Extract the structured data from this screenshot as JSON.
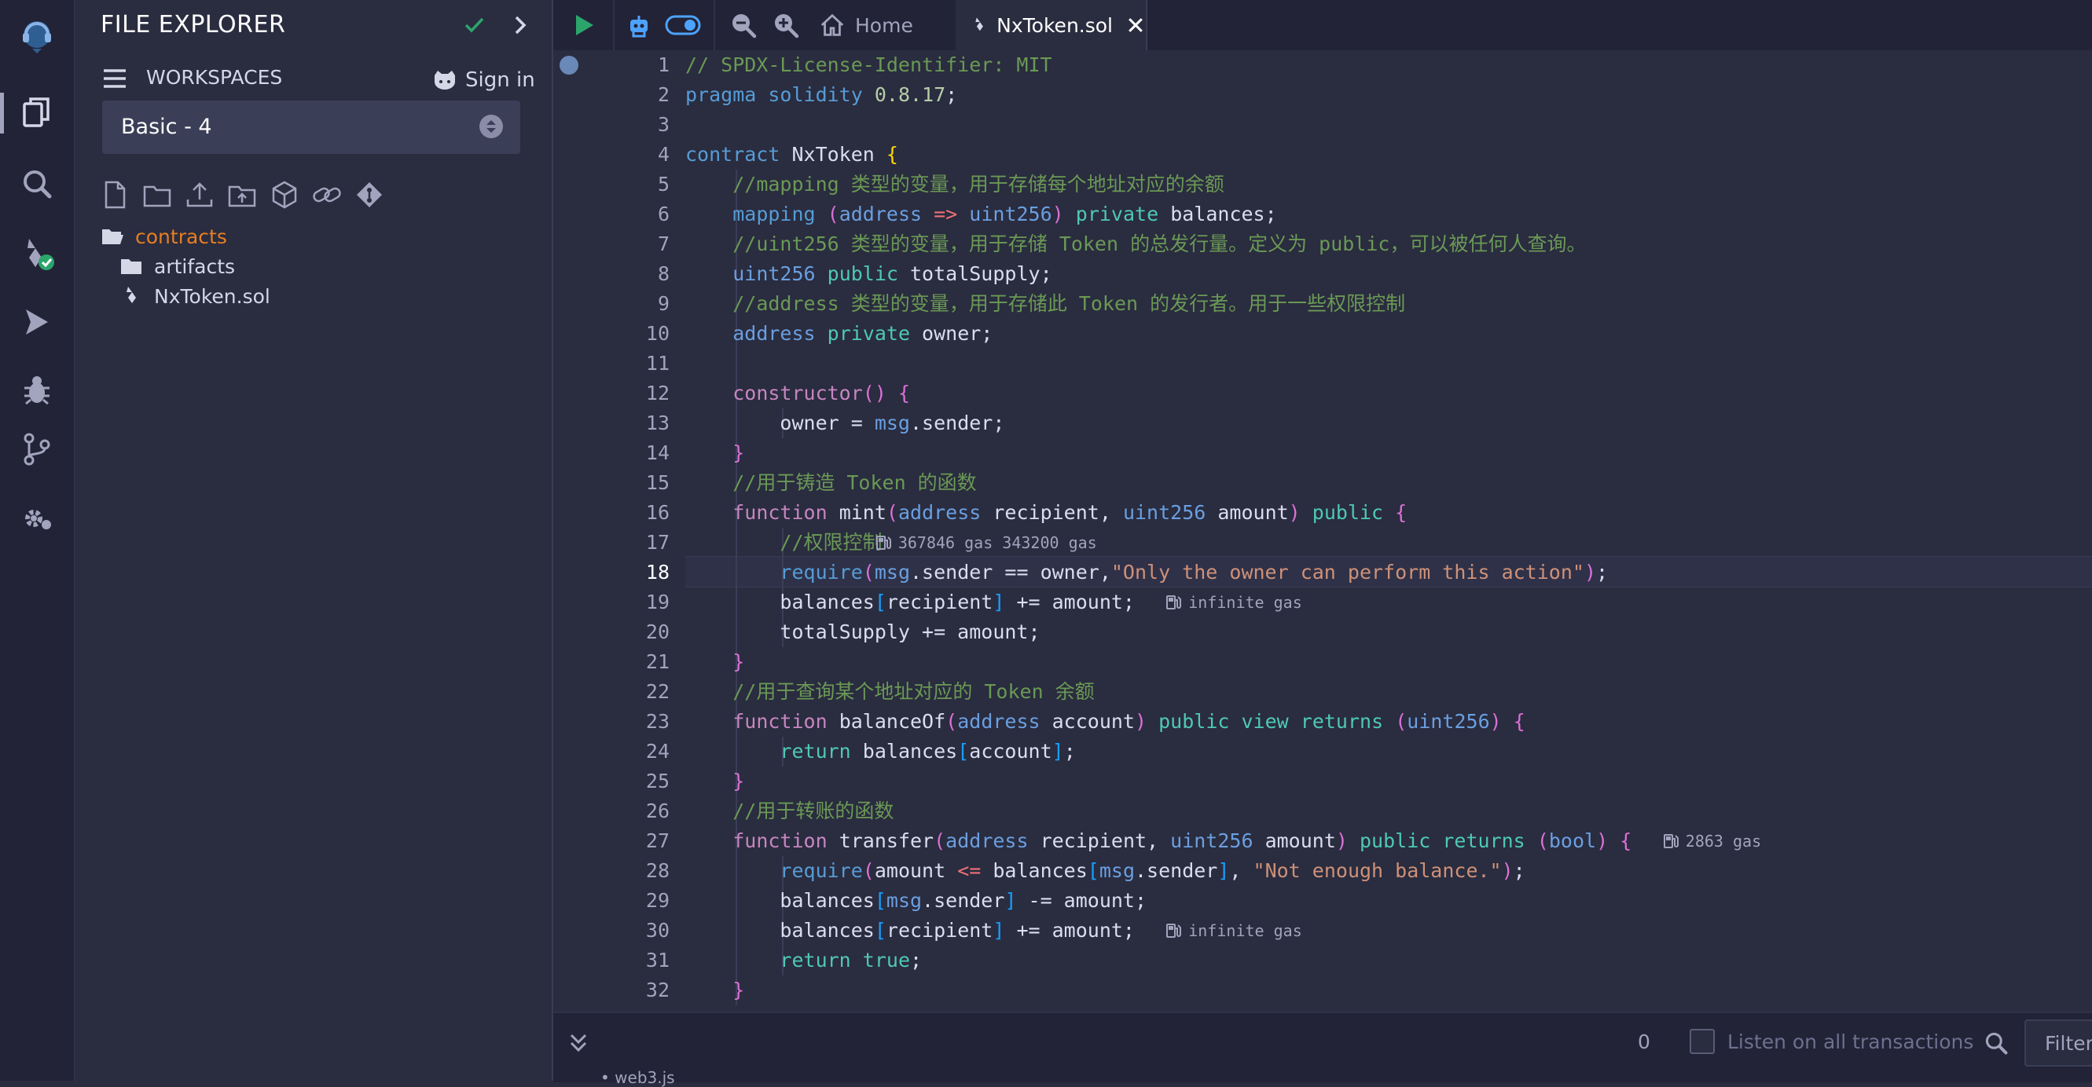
{
  "explorer": {
    "title": "FILE EXPLORER",
    "workspaces_label": "WORKSPACES",
    "sign_in": "Sign in",
    "workspace_selected": "Basic - 4",
    "tree": [
      {
        "name": "contracts",
        "type": "folder-open",
        "color": "#e67e22"
      },
      {
        "name": "artifacts",
        "type": "folder",
        "color": "#d5d6e6"
      },
      {
        "name": "NxToken.sol",
        "type": "file",
        "color": "#d5d6e6"
      }
    ]
  },
  "tabs": {
    "home": "Home",
    "active": "NxToken.sol"
  },
  "rail_icons": [
    "remix-logo-icon",
    "file-explorer-icon",
    "search-icon",
    "solidity-compiler-icon",
    "deploy-run-icon",
    "debugger-icon",
    "git-icon",
    "plugin-manager-icon"
  ],
  "editor": {
    "current_line": 18,
    "lines": [
      "// SPDX-License-Identifier: MIT",
      "pragma solidity 0.8.17;",
      "",
      "contract NxToken {",
      "    //mapping 类型的变量，用于存储每个地址对应的余额",
      "    mapping (address => uint256) private balances;",
      "    //uint256 类型的变量，用于存储 Token 的总发行量。定义为 public，可以被任何人查询。",
      "    uint256 public totalSupply;",
      "    //address 类型的变量，用于存储此 Token 的发行者。用于一些权限控制",
      "    address private owner;",
      "",
      "    constructor() {",
      "        owner = msg.sender;",
      "    }",
      "    //用于铸造 Token 的函数",
      "    function mint(address recipient, uint256 amount) public {",
      "        //权限控制",
      "        require(msg.sender == owner,\"Only the owner can perform this action\");",
      "        balances[recipient] += amount;",
      "        totalSupply += amount;",
      "    }",
      "    //用于查询某个地址对应的 Token 余额",
      "    function balanceOf(address account) public view returns (uint256) {",
      "        return balances[account];",
      "    }",
      "    //用于转账的函数",
      "    function transfer(address recipient, uint256 amount) public returns (bool) {",
      "        require(amount <= balances[msg.sender], \"Not enough balance.\");",
      "        balances[msg.sender] -= amount;",
      "        balances[recipient] += amount;",
      "        return true;",
      "    }"
    ],
    "gas_hints": [
      {
        "line": 17,
        "text": "367846 gas 343200 gas"
      },
      {
        "line": 19,
        "text": "infinite gas"
      },
      {
        "line": 27,
        "text": "2863 gas"
      },
      {
        "line": 30,
        "text": "infinite gas"
      }
    ]
  },
  "terminal": {
    "count": "0",
    "listen_label": "Listen on all transactions",
    "filter_placeholder": "Filter",
    "log_item": "web3.js"
  }
}
